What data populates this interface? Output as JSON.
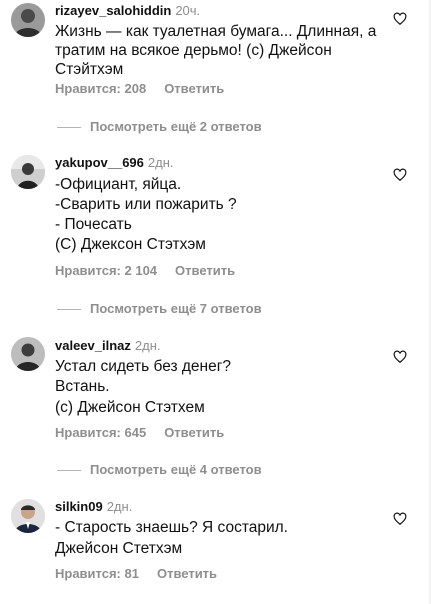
{
  "comments": [
    {
      "username": "rizayev_salohiddin",
      "time": "20ч.",
      "lines": [
        "Жизнь — как туалетная бумага... Длинная, а",
        "тратим на всякое дерьмо! (с) Джейсон",
        "Стэйтхэм"
      ],
      "likes": "Нравится: 208",
      "reply": "Ответить",
      "view_replies": "Посмотреть ещё 2 ответов",
      "avatar_icon": "avatar-man-icon"
    },
    {
      "username": "yakupov__696",
      "time": "2дн.",
      "lines": [
        "-Официант, яйца.",
        "-Сварить или пожарить ?",
        "- Почесать",
        "(С) Джексон Стэтхэм"
      ],
      "likes": "Нравится: 2 104",
      "reply": "Ответить",
      "view_replies": "Посмотреть ещё 7 ответов",
      "avatar_icon": "avatar-person-icon"
    },
    {
      "username": "valeev_ilnaz",
      "time": "2дн.",
      "lines": [
        "Устал сидеть без денег?",
        "Встань.",
        "(с) Джейсон Стэтхем"
      ],
      "likes": "Нравится: 645",
      "reply": "Ответить",
      "view_replies": "Посмотреть ещё 4 ответов",
      "avatar_icon": "avatar-man-icon"
    },
    {
      "username": "silkin09",
      "time": "2дн.",
      "lines": [
        "- Старость знаешь? Я состарил.",
        "Джейсон Стетхэм"
      ],
      "likes": "Нравится: 81",
      "reply": "Ответить",
      "avatar_icon": "avatar-man-suit-icon"
    }
  ],
  "icons": {
    "like": "heart-outline-icon"
  },
  "colors": {
    "text": "#111111",
    "secondary": "#8e8e8e",
    "background": "#ffffff"
  }
}
